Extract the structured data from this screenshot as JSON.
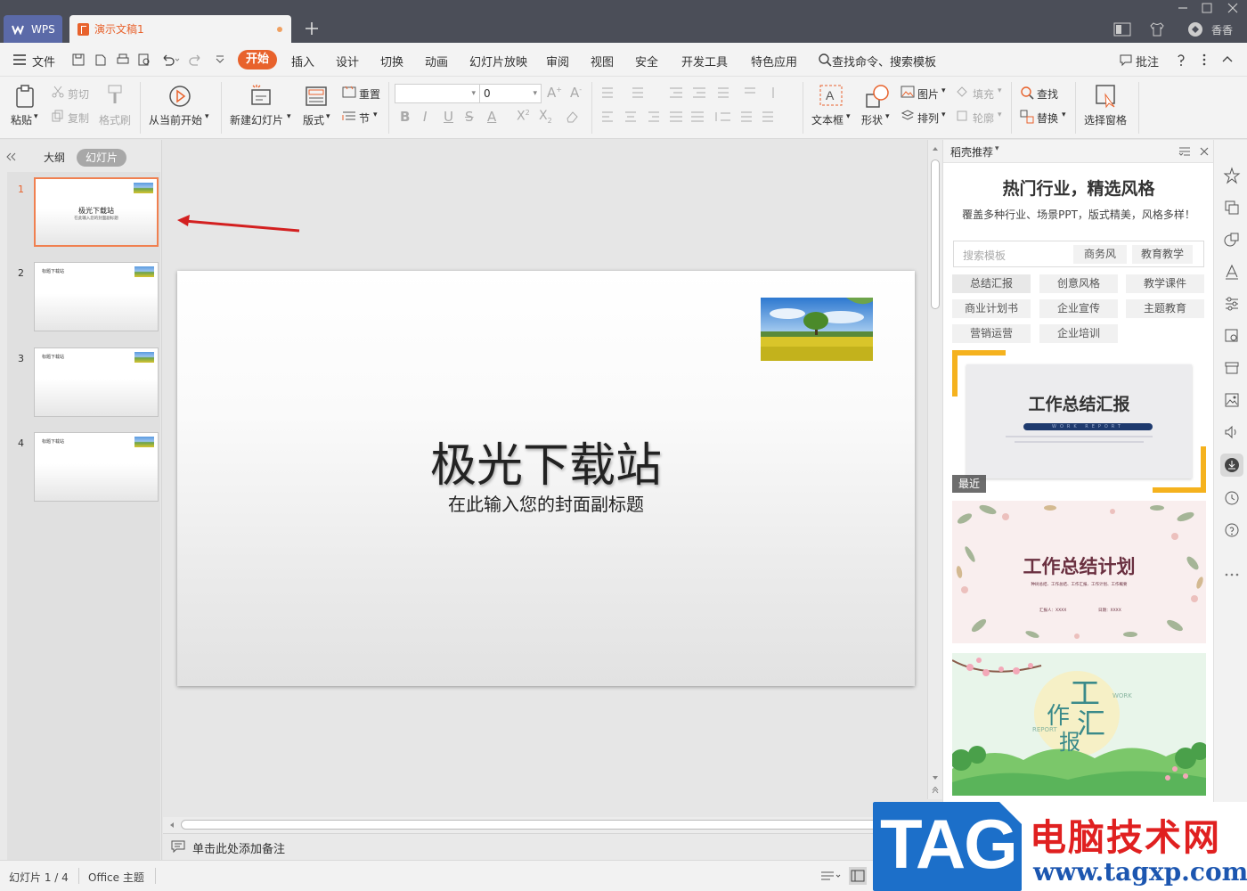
{
  "titlebar": {
    "wps_tab": "WPS",
    "doc_tab": "演示文稿1",
    "user": "香香"
  },
  "menubar": {
    "file": "文件",
    "tabs": [
      "开始",
      "插入",
      "设计",
      "切换",
      "动画",
      "幻灯片放映",
      "审阅",
      "视图",
      "安全",
      "开发工具",
      "特色应用"
    ],
    "search": "查找命令、搜索模板",
    "comment": "批注"
  },
  "ribbon": {
    "paste": "粘贴",
    "cut": "剪切",
    "copy": "复制",
    "format_painter": "格式刷",
    "from_current": "从当前开始",
    "new_slide": "新建幻灯片",
    "layout": "版式",
    "reset": "重置",
    "section": "节",
    "font_size": "0",
    "textbox": "文本框",
    "shape": "形状",
    "picture": "图片",
    "fill": "填充",
    "arrange": "排列",
    "outline": "轮廓",
    "find": "查找",
    "replace": "替换",
    "selection_pane": "选择窗格"
  },
  "leftpanel": {
    "tab_outline": "大纲",
    "tab_slides": "幻灯片",
    "slides": [
      {
        "num": "1",
        "title": "极光下载站",
        "subtitle": "在此输入您的封面副标题"
      },
      {
        "num": "2",
        "title": "标题下载站"
      },
      {
        "num": "3",
        "title": "标题下载站"
      },
      {
        "num": "4",
        "title": "标题下载站"
      }
    ]
  },
  "slide": {
    "title": "极光下载站",
    "subtitle": "在此输入您的封面副标题"
  },
  "notes": {
    "placeholder": "单击此处添加备注"
  },
  "rightpanel": {
    "header": "稻壳推荐",
    "headline": "热门行业，精选风格",
    "sub": "覆盖多种行业、场景PPT，版式精美，风格多样！",
    "search_placeholder": "搜索模板",
    "search_tags": [
      "商务风",
      "教育教学"
    ],
    "categories": [
      "总结汇报",
      "创意风格",
      "教学课件",
      "商业计划书",
      "企业宣传",
      "主题教育",
      "营销运营",
      "企业培训"
    ],
    "templates": [
      {
        "title": "工作总结汇报",
        "en": "WORK REPORT",
        "badge": "最近"
      },
      {
        "title": "工作总结计划",
        "line1": "种树总结、工作总结、工作汇报、工作计划、工作概要",
        "reporter": "汇报人：XXXX",
        "date": "日期：XXXX"
      },
      {
        "chars": [
          "工",
          "作",
          "汇",
          "报"
        ],
        "en1": "WORK",
        "en2": "REPORT"
      }
    ]
  },
  "statusbar": {
    "slide_count": "幻灯片 1 / 4",
    "theme": "Office 主题"
  },
  "watermark": {
    "tag": "TAG",
    "site_name": "电脑技术网",
    "url": "www.tagxp.com"
  },
  "colors": {
    "accent": "#e8622c",
    "titlebar": "#4b4e58",
    "wps_blue": "#5b6aa8"
  }
}
